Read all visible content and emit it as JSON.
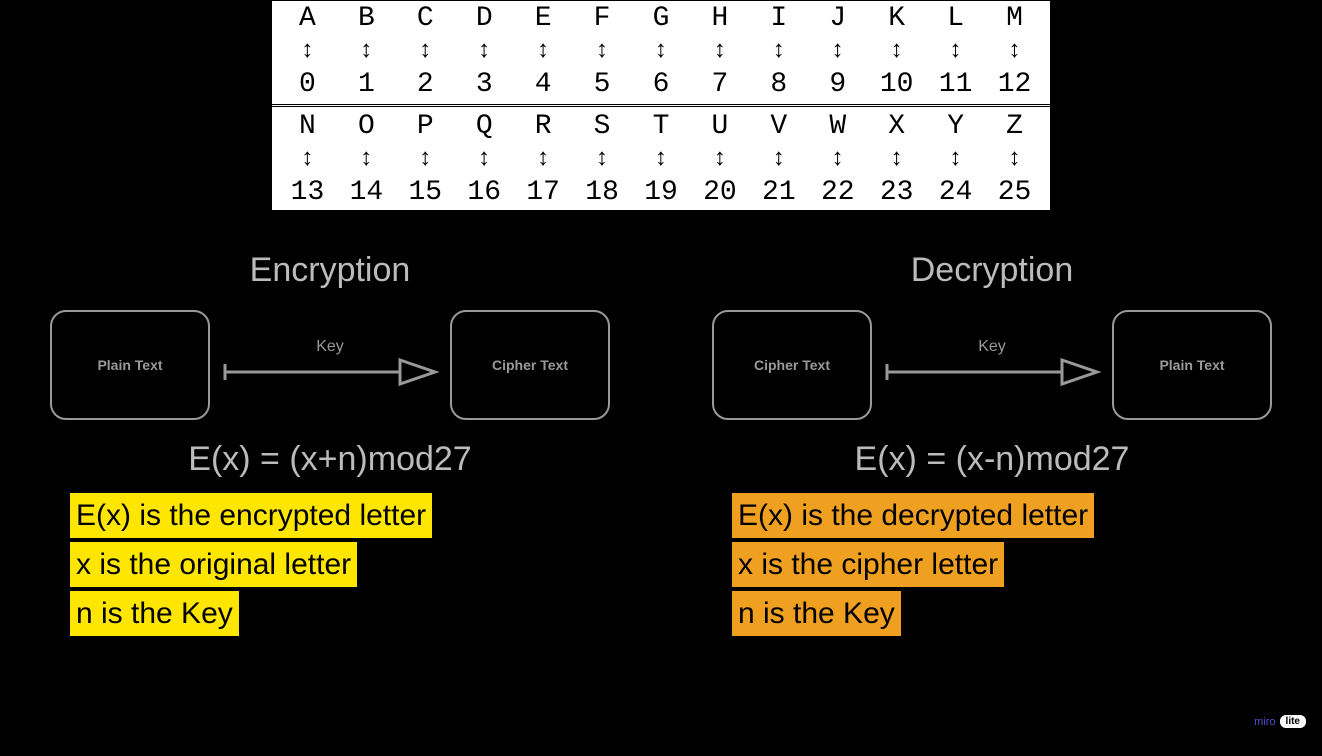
{
  "alphabet": {
    "row1_letters": [
      "A",
      "B",
      "C",
      "D",
      "E",
      "F",
      "G",
      "H",
      "I",
      "J",
      "K",
      "L",
      "M"
    ],
    "row1_numbers": [
      "0",
      "1",
      "2",
      "3",
      "4",
      "5",
      "6",
      "7",
      "8",
      "9",
      "10",
      "11",
      "12"
    ],
    "row2_letters": [
      "N",
      "O",
      "P",
      "Q",
      "R",
      "S",
      "T",
      "U",
      "V",
      "W",
      "X",
      "Y",
      "Z"
    ],
    "row2_numbers": [
      "13",
      "14",
      "15",
      "16",
      "17",
      "18",
      "19",
      "20",
      "21",
      "22",
      "23",
      "24",
      "25"
    ],
    "arrow_glyph": "↕"
  },
  "encryption": {
    "title": "Encryption",
    "box_left": "Plain Text",
    "box_right": "Cipher Text",
    "key_label": "Key",
    "formula": "E(x) = (x+n)mod27",
    "lines": {
      "l1": "E(x) is the encrypted letter",
      "l2": "x is the original letter",
      "l3": "n is the Key"
    }
  },
  "decryption": {
    "title": "Decryption",
    "box_left": "Cipher Text",
    "box_right": "Plain Text",
    "key_label": "Key",
    "formula": "E(x) = (x-n)mod27",
    "lines": {
      "l1": "E(x) is the decrypted letter",
      "l2": "x is the cipher letter",
      "l3": "n is the Key"
    }
  },
  "watermark": {
    "brand": "miro",
    "badge": "lite"
  }
}
